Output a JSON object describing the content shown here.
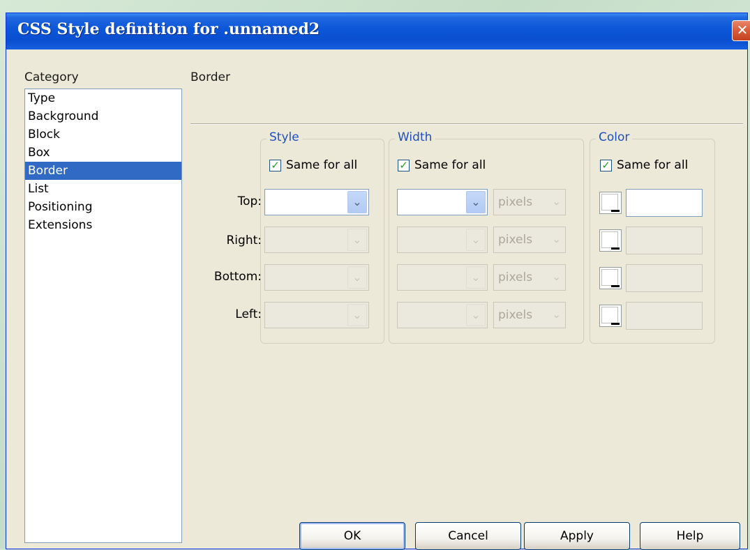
{
  "window": {
    "title": "CSS Style definition for .unnamed2",
    "close_glyph": "✕"
  },
  "category": {
    "label": "Category",
    "items": [
      "Type",
      "Background",
      "Block",
      "Box",
      "Border",
      "List",
      "Positioning",
      "Extensions"
    ],
    "selected": "Border"
  },
  "panel": {
    "heading": "Border"
  },
  "style_group": {
    "title": "Style",
    "same_for_all_label": "Same for all",
    "same_for_all_checked": true
  },
  "width_group": {
    "title": "Width",
    "same_for_all_label": "Same for all",
    "same_for_all_checked": true,
    "unit": "pixels"
  },
  "color_group": {
    "title": "Color",
    "same_for_all_label": "Same for all",
    "same_for_all_checked": true
  },
  "rows": {
    "top": "Top:",
    "right": "Right:",
    "bottom": "Bottom:",
    "left": "Left:"
  },
  "glyphs": {
    "check": "✓",
    "arrow": "⌄"
  },
  "buttons": {
    "ok": "OK",
    "cancel": "Cancel",
    "apply": "Apply",
    "help": "Help"
  },
  "colors": {
    "titlebar": "#0b56d8",
    "dialog_bg": "#ece9d8",
    "selection": "#316ac5",
    "group_title": "#1f4fbf"
  }
}
